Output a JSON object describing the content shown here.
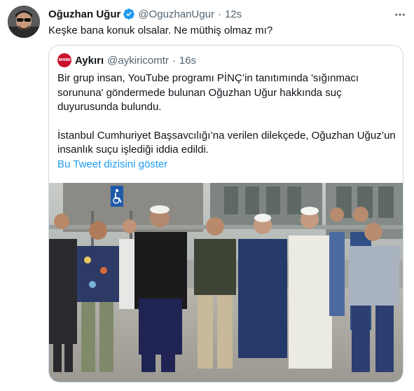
{
  "tweet": {
    "author_name": "Oğuzhan Uğur",
    "author_handle": "@OguzhanUgur",
    "separator": "·",
    "time": "12s",
    "text": "Keşke bana konuk olsalar. Ne müthiş olmaz mı?"
  },
  "quote": {
    "logo_text": "AYKIRI",
    "author_name": "Aykırı",
    "author_handle": "@aykiricomtr",
    "separator": "·",
    "time": "16s",
    "lines": [
      "Bir grup insan, YouTube programı PİNÇ’in tanıtımında 'sığınmacı",
      "sorununa' göndermede bulunan Oğuzhan Uğur hakkında suç",
      "duyurusunda bulundu."
    ],
    "lines2": [
      "İstanbul Cumhuriyet Başsavcılığı’na verilen dilekçede, Oğuzhan Uğuz’un",
      "insanlık suçu işlediği iddia edildi."
    ],
    "show_thread": "Bu Tweet dizisini göster"
  },
  "colors": {
    "text": "#0f1419",
    "secondary": "#536471",
    "link": "#1d9bf0",
    "verified": "#1d9bf0",
    "border": "#cfd9de"
  },
  "icons": [
    "verified-badge-icon",
    "more-options-icon",
    "accessibility-sign-icon"
  ]
}
